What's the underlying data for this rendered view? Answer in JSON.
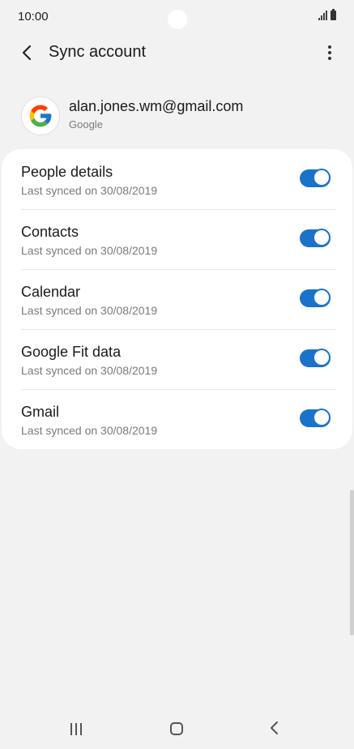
{
  "status_bar": {
    "time": "10:00"
  },
  "app_bar": {
    "title": "Sync account"
  },
  "account": {
    "email": "alan.jones.wm@gmail.com",
    "type": "Google"
  },
  "sync_items": [
    {
      "title": "People details",
      "subtitle": "Last synced on 30/08/2019",
      "enabled": true
    },
    {
      "title": "Contacts",
      "subtitle": "Last synced on 30/08/2019",
      "enabled": true
    },
    {
      "title": "Calendar",
      "subtitle": "Last synced on 30/08/2019",
      "enabled": true
    },
    {
      "title": "Google Fit data",
      "subtitle": "Last synced on 30/08/2019",
      "enabled": true
    },
    {
      "title": "Gmail",
      "subtitle": "Last synced on 30/08/2019",
      "enabled": true
    }
  ],
  "colors": {
    "accent": "#1a73c9",
    "background": "#f2f2f2",
    "card": "#ffffff"
  },
  "icons": {
    "back": "chevron-left-icon",
    "more": "more-vertical-icon",
    "avatar": "google-logo-icon",
    "nav_recents": "recents-icon",
    "nav_home": "home-icon",
    "nav_back": "back-icon"
  }
}
